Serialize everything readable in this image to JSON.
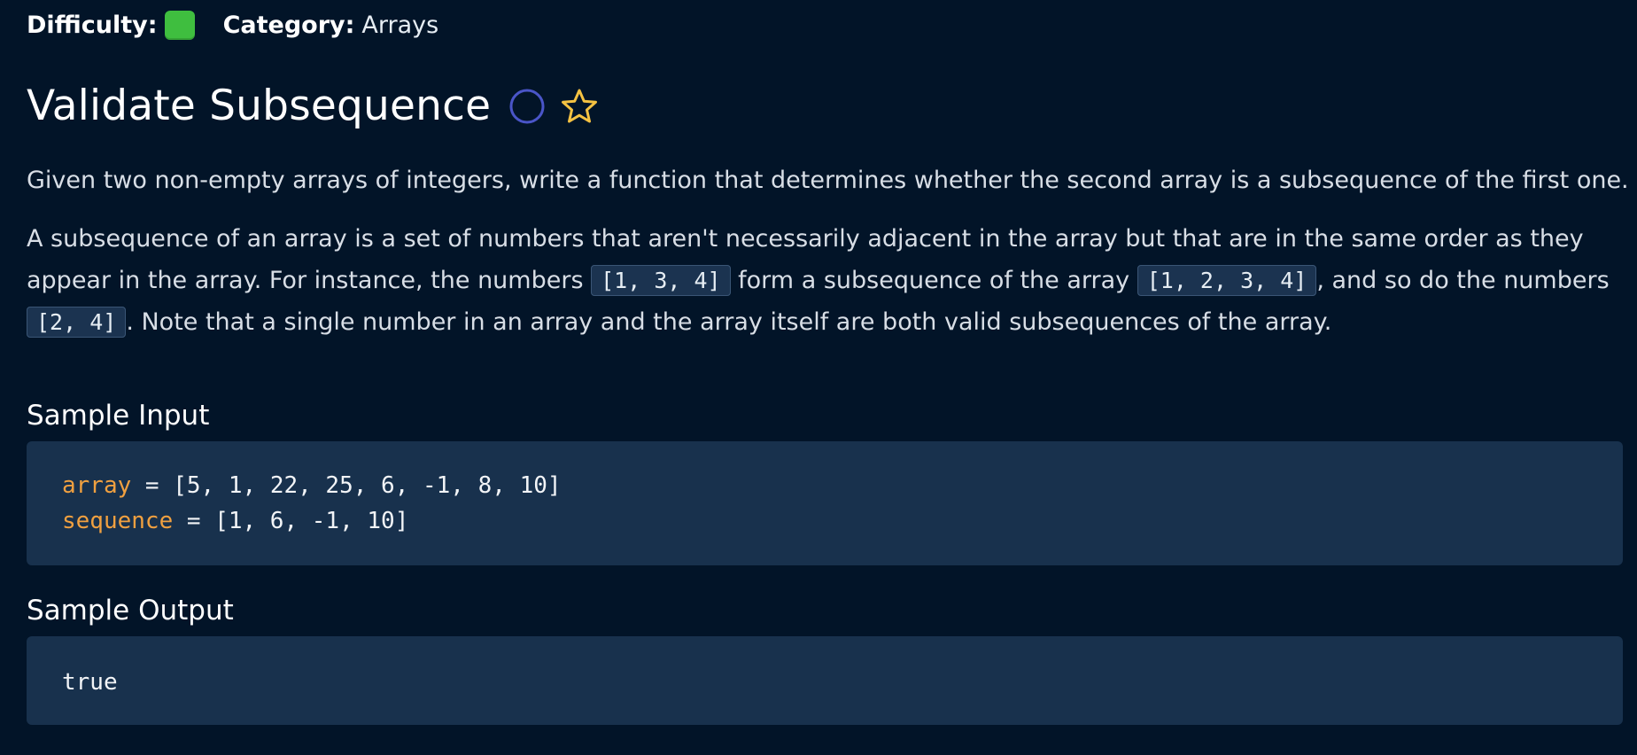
{
  "meta": {
    "difficulty_label": "Difficulty:",
    "category_label": "Category:",
    "category_value": "Arrays",
    "difficulty_color": "#3fbe3f"
  },
  "problem": {
    "title": "Validate Subsequence",
    "status_icon": "circle-outline-icon",
    "favorite_icon": "star-outline-icon",
    "description_p1": "Given two non-empty arrays of integers, write a function that determines whether the second array is a subsequence of the first one.",
    "description_p2": {
      "part1": "A subsequence of an array is a set of numbers that aren't necessarily adjacent in the array but that are in the same order as they appear in the array. For instance, the numbers ",
      "code1": "[1, 3, 4]",
      "part2": " form a subsequence of the array ",
      "code2": "[1, 2, 3, 4]",
      "part3": ", and so do the numbers ",
      "code3": "[2, 4]",
      "part4": ". Note that a single number in an array and the array itself are both valid subsequences of the array."
    }
  },
  "sample_input": {
    "heading": "Sample Input",
    "lines": [
      {
        "var": "array",
        "rest": " = [5, 1, 22, 25, 6, -1, 8, 10]"
      },
      {
        "var": "sequence",
        "rest": " = [1, 6, -1, 10]"
      }
    ]
  },
  "sample_output": {
    "heading": "Sample Output",
    "value": "true"
  },
  "colors": {
    "background": "#021428",
    "code_background": "#18314d",
    "variable": "#f0a040",
    "star": "#f5c242",
    "status_circle": "#4a55c8"
  }
}
